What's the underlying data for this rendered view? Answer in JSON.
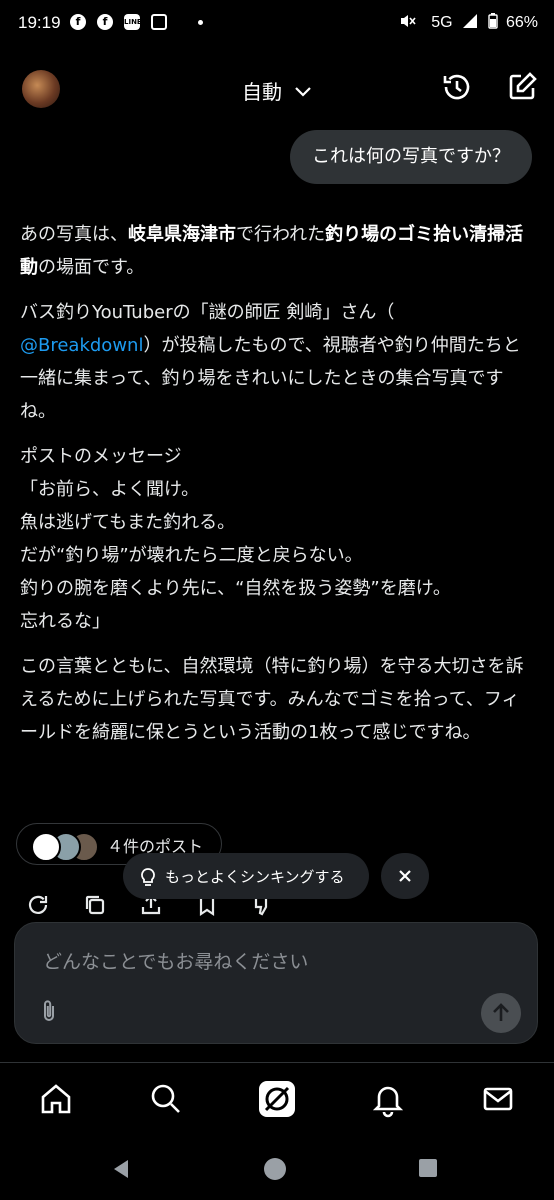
{
  "status_bar": {
    "time": "19:19",
    "network": "5G",
    "battery": "66%"
  },
  "header": {
    "mode_label": "自動"
  },
  "user_message": "これは何の写真ですか？",
  "response": {
    "p1_bold_a": "岐阜県海津市",
    "p1_pre": "あの写真は、",
    "p1_mid": "で行われた",
    "p1_bold_b": "釣り場のゴミ拾い清掃活動",
    "p1_post": "の場面です。",
    "p2_pre": "バス釣りYouTuberの「謎の師匠 剣崎」さん（",
    "p2_link": "@Breakdownl",
    "p2_post": "）が投稿したもので、視聴者や釣り仲間たちと一緒に集まって、釣り場をきれいにしたときの集合写真ですね。",
    "p3_lines": [
      "ポストのメッセージ",
      "「お前ら、よく聞け。",
      "魚は逃げてもまた釣れる。",
      "だが“釣り場”が壊れたら二度と戻らない。",
      "釣りの腕を磨くより先に、“自然を扱う姿勢”を磨け。",
      "忘れるな」"
    ],
    "p4": "この言葉とともに、自然環境（特に釣り場）を守る大切さを訴えるために上げられた写真です。みんなでゴミを拾って、フィールドを綺麗に保とうという活動の1枚って感じですね。"
  },
  "sources": {
    "label": "４件のポスト"
  },
  "think_suggestion": {
    "label": "もっとよくシンキングする"
  },
  "composer": {
    "placeholder": "どんなことでもお尋ねください"
  },
  "icons": [
    "history-icon",
    "new-chat-icon",
    "regenerate-icon",
    "copy-icon",
    "share-icon",
    "bookmark-icon",
    "dislike-icon",
    "attach-icon",
    "send-icon",
    "home-icon",
    "search-icon",
    "grok-icon",
    "bell-icon",
    "mail-icon"
  ]
}
